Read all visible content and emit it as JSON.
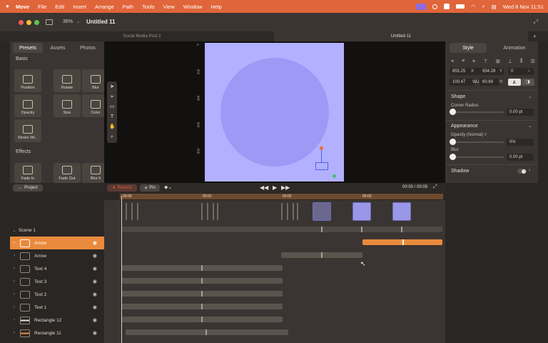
{
  "menubar": {
    "app_name": "Move",
    "items": [
      "File",
      "Edit",
      "Insert",
      "Arrange",
      "Path",
      "Tools",
      "View",
      "Window",
      "Help"
    ],
    "clock": "Wed 8 Nov  11:51"
  },
  "window": {
    "zoom": "36%",
    "title": "Untitled 11"
  },
  "tabs": [
    "Social Media Post 2",
    "Untitled 11"
  ],
  "left_panel": {
    "tabs": [
      "Presets",
      "Assets",
      "Photos"
    ],
    "basic_label": "Basic",
    "tiles": [
      "Position",
      "Rotate",
      "Blur",
      "Opacity",
      "Size",
      "Color",
      "Stroke Wi..."
    ],
    "effects_label": "Effects",
    "effect_tiles": [
      "Fade In",
      "Fade Out",
      "Blur It"
    ]
  },
  "ruler_marks": [
    "0",
    "200",
    "400",
    "600",
    "800"
  ],
  "right_panel": {
    "tabs": [
      "Style",
      "Animation"
    ],
    "x_value": "855.25",
    "x_label": "X",
    "y_value": "934.28",
    "y_label": "Y",
    "rot_value": "0",
    "w_value": "100.47",
    "w_label": "W",
    "h_value": "60.69",
    "h_label": "H",
    "shape_label": "Shape",
    "corner_label": "Corner Radius",
    "corner_value": "0.00 pt",
    "appearance_label": "Appearance",
    "opacity_label": "Opacity (Normal) ◊",
    "opacity_value": "0%",
    "blur_label": "Blur",
    "blur_value": "0.00 pt",
    "shadow_label": "Shadow"
  },
  "transport": {
    "project_label": "Project",
    "record_label": "Record",
    "pin_label": "Pin",
    "time": "00:00 / 00:05"
  },
  "timeline_ticks": [
    "00:00",
    "00:01",
    "00:02",
    "00:03"
  ],
  "layers": {
    "scene": "Scene 1",
    "rows": [
      "Arrow",
      "Arrow",
      "Text 4",
      "Text 3",
      "Text 2",
      "Text 1",
      "Rectangle 12",
      "Rectangle 11"
    ]
  }
}
